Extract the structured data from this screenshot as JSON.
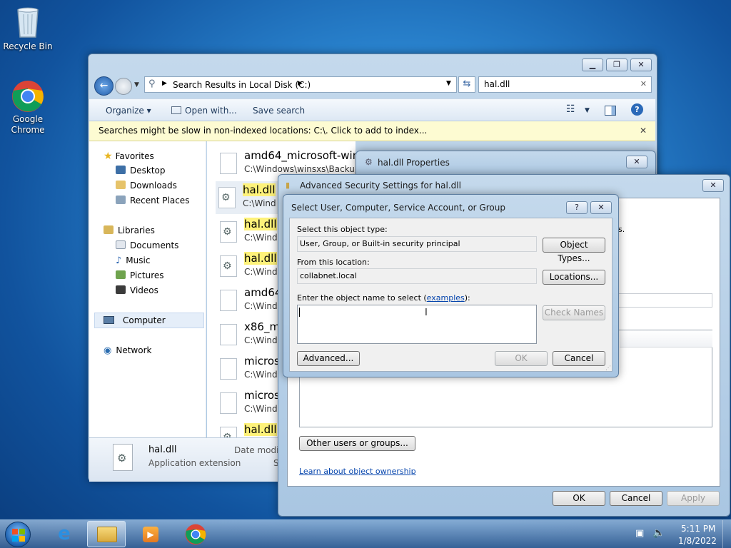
{
  "desktop": {
    "icons": [
      {
        "label": "Recycle Bin"
      },
      {
        "label_line1": "Google",
        "label_line2": "Chrome"
      }
    ]
  },
  "explorer": {
    "address": {
      "path": "Search Results in Local Disk (C:)"
    },
    "search": {
      "value": "hal.dll"
    },
    "toolbar": {
      "organize": "Organize",
      "open_with": "Open with...",
      "save_search": "Save search"
    },
    "infobar": "Searches might be slow in non-indexed locations: C:\\. Click to add to index...",
    "nav": {
      "favorites": "Favorites",
      "desktop": "Desktop",
      "downloads": "Downloads",
      "recent": "Recent Places",
      "libraries": "Libraries",
      "documents": "Documents",
      "music": "Music",
      "pictures": "Pictures",
      "videos": "Videos",
      "computer": "Computer",
      "network": "Network"
    },
    "results": [
      {
        "name": "amd64_microsoft-wind",
        "path": "C:\\Windows\\winsxs\\Backup",
        "hl": false,
        "dll": false
      },
      {
        "name": "hal.dll",
        "path": "C:\\Wind",
        "hl": true,
        "dll": true
      },
      {
        "name": "hal.dll",
        "path": "C:\\Wind",
        "hl": true,
        "dll": true
      },
      {
        "name": "hal.dll",
        "path": "C:\\Wind",
        "hl": true,
        "dll": true
      },
      {
        "name": "amd64",
        "path": "C:\\Wind",
        "hl": false,
        "dll": false
      },
      {
        "name": "x86_m",
        "path": "C:\\Wind",
        "hl": false,
        "dll": false
      },
      {
        "name": "micros",
        "path": "C:\\Wind",
        "hl": false,
        "dll": false
      },
      {
        "name": "micros",
        "path": "C:\\Wind",
        "hl": false,
        "dll": false
      },
      {
        "name": "hal.dll",
        "path": "",
        "hl": true,
        "dll": true
      }
    ],
    "status": {
      "name": "hal.dll",
      "type": "Application extension",
      "date_label": "Date modifi",
      "size_label": "S"
    }
  },
  "properties": {
    "title": "hal.dll Properties"
  },
  "advanced": {
    "title": "Advanced Security Settings for hal.dll",
    "other_users_button": "Other users or groups...",
    "learn_link": "Learn about object ownership",
    "ok": "OK",
    "cancel": "Cancel",
    "apply": "Apply"
  },
  "select_dialog": {
    "title": "Select User, Computer, Service Account, or Group",
    "object_type_label": "Select this object type:",
    "object_type_value": "User, Group, or Built-in security principal",
    "object_types_button": "Object Types...",
    "location_label": "From this location:",
    "location_value": "collabnet.local",
    "locations_button": "Locations...",
    "enter_label": "Enter the object name to select (",
    "examples_link": "examples",
    "enter_label_end": "):",
    "check_names_button": "Check Names",
    "advanced_button": "Advanced...",
    "ok": "OK",
    "cancel": "Cancel"
  },
  "taskbar": {
    "time": "5:11 PM",
    "date": "1/8/2022"
  }
}
